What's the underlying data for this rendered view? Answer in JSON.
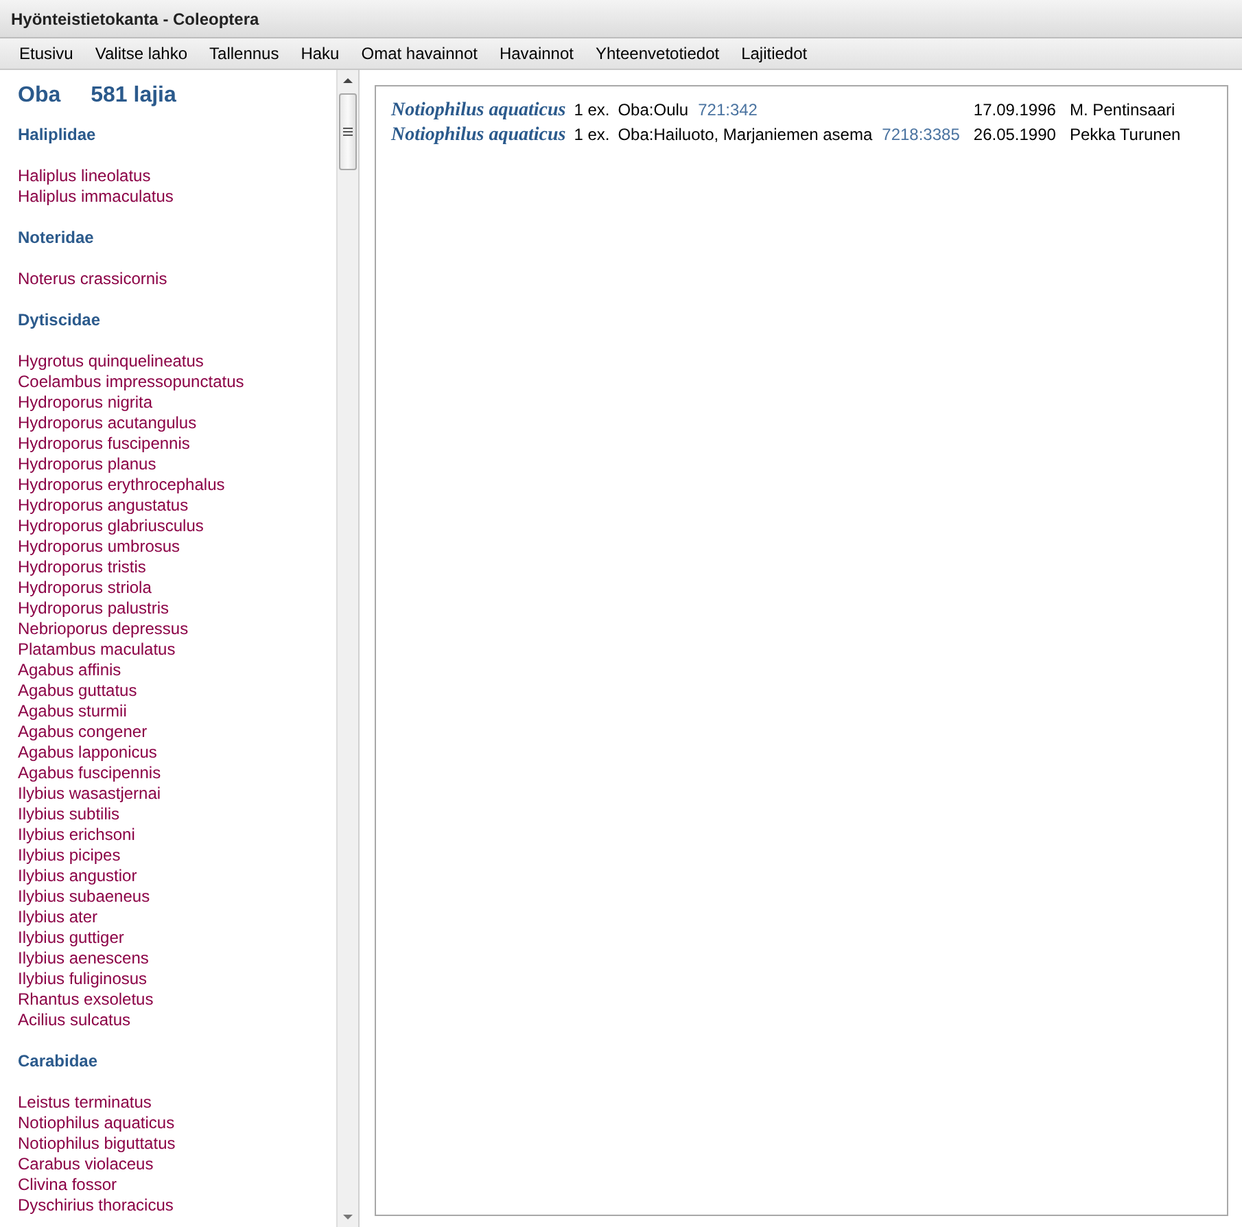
{
  "window": {
    "title": "Hyönteistietokanta - Coleoptera"
  },
  "menu": [
    "Etusivu",
    "Valitse lahko",
    "Tallennus",
    "Haku",
    "Omat havainnot",
    "Havainnot",
    "Yhteenvetotiedot",
    "Lajitiedot"
  ],
  "sidebar": {
    "area": "Oba",
    "count": "581 lajia",
    "families": [
      {
        "name": "Haliplidae",
        "species": [
          "Haliplus lineolatus",
          "Haliplus immaculatus"
        ]
      },
      {
        "name": "Noteridae",
        "species": [
          "Noterus crassicornis"
        ]
      },
      {
        "name": "Dytiscidae",
        "species": [
          "Hygrotus quinquelineatus",
          "Coelambus impressopunctatus",
          "Hydroporus nigrita",
          "Hydroporus acutangulus",
          "Hydroporus fuscipennis",
          "Hydroporus planus",
          "Hydroporus erythrocephalus",
          "Hydroporus angustatus",
          "Hydroporus glabriusculus",
          "Hydroporus umbrosus",
          "Hydroporus tristis",
          "Hydroporus striola",
          "Hydroporus palustris",
          "Nebrioporus depressus",
          "Platambus maculatus",
          "Agabus affinis",
          "Agabus guttatus",
          "Agabus sturmii",
          "Agabus congener",
          "Agabus lapponicus",
          "Agabus fuscipennis",
          "Ilybius wasastjernai",
          "Ilybius subtilis",
          "Ilybius erichsoni",
          "Ilybius picipes",
          "Ilybius angustior",
          "Ilybius subaeneus",
          "Ilybius ater",
          "Ilybius guttiger",
          "Ilybius aenescens",
          "Ilybius fuliginosus",
          "Rhantus exsoletus",
          "Acilius sulcatus"
        ]
      },
      {
        "name": "Carabidae",
        "species": [
          "Leistus terminatus",
          "Notiophilus aquaticus",
          "Notiophilus biguttatus",
          "Carabus violaceus",
          "Clivina fossor",
          "Dyschirius thoracicus"
        ]
      }
    ]
  },
  "observations": [
    {
      "species": "Notiophilus aquaticus",
      "count": "1 ex.",
      "place": "Oba:Oulu",
      "grid": "721:342",
      "date": "17.09.1996",
      "observer": "M. Pentinsaari"
    },
    {
      "species": "Notiophilus aquaticus",
      "count": "1 ex.",
      "place": "Oba:Hailuoto, Marjaniemen asema",
      "grid": "7218:3385",
      "date": "26.05.1990",
      "observer": "Pekka Turunen"
    }
  ]
}
